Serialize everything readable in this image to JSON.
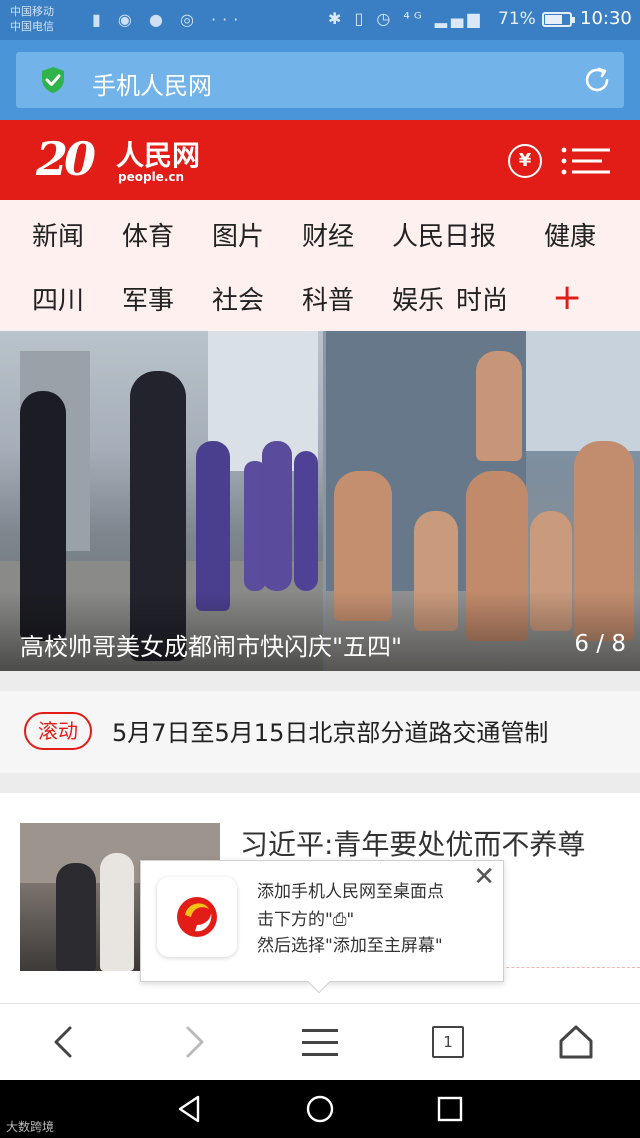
{
  "status_bar": {
    "carrier_1": "中国移动",
    "carrier_2": "中国电信",
    "left_icons": "▮ ◉ ● ◎ ···",
    "right_icons": "✱ ▯ ◷ ⁴ᴳ ▂▄▆",
    "battery_percent": "71%",
    "battery_level": 0.71,
    "time": "10:30"
  },
  "address_bar": {
    "title": "手机人民网",
    "secure_icon": "shield-check-icon",
    "reload_icon": "reload-icon"
  },
  "header": {
    "logo_number": "20",
    "logo_name": "人民网",
    "logo_domain": "people.cn",
    "yen_symbol": "¥",
    "menu_icon": "hamburger-menu-icon",
    "brand_red": "#e21d18"
  },
  "nav": {
    "row1": [
      "新闻",
      "体育",
      "图片",
      "财经",
      "人民日报",
      "健康"
    ],
    "row2": [
      "四川",
      "军事",
      "社会",
      "科普",
      "娱乐",
      "时尚"
    ],
    "more": "+"
  },
  "hero": {
    "caption": "高校帅哥美女成都闹市快闪庆\"五四\"",
    "pager": "6 / 8"
  },
  "ticker": {
    "badge": "滚动",
    "headline": "5月7日至5月15日北京部分道路交通管制"
  },
  "news": {
    "title": "习近平:青年要处优而不养尊"
  },
  "popup": {
    "line1": "添加手机人民网至桌面点",
    "line2": "击下方的\"⎙\"",
    "line3": "然后选择\"添加至主屏幕\"",
    "close": "✕"
  },
  "toolbar": {
    "tab_count": "1"
  },
  "watermark": "大数跨境"
}
